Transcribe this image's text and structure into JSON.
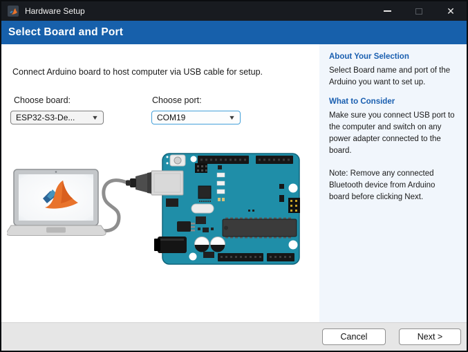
{
  "window": {
    "title": "Hardware Setup"
  },
  "icons": {
    "app": "matlab-logo",
    "minimize": "minimize-dash",
    "maximize": "maximize-square",
    "close": "✕",
    "dropdown_arrow": "▼"
  },
  "header": {
    "title": "Select Board and Port"
  },
  "main": {
    "instruction": "Connect Arduino board to host computer via USB cable for setup.",
    "board_label": "Choose board:",
    "board_value": "ESP32-S3-De...",
    "port_label": "Choose port:",
    "port_value": "COM19"
  },
  "sidebar": {
    "about_heading": "About Your Selection",
    "about_body": "Select Board name and port of the Arduino you want to set up.",
    "consider_heading": "What to Consider",
    "consider_body": "Make sure you connect USB port to the computer and switch on any power adapter connected to the board.",
    "consider_note": "Note: Remove any connected Bluetooth device from Arduino board before clicking Next."
  },
  "footer": {
    "cancel_label": "Cancel",
    "next_label": "Next >"
  },
  "colors": {
    "titlebar_bg": "#181b20",
    "header_blue": "#1760ab",
    "sidebar_bg": "#f1f6fc",
    "sidebar_heading_blue": "#1a5fb0",
    "board_teal": "#1f8ea8",
    "focus_border_blue": "#44a0d9",
    "matlab_orange": "#e8732c"
  }
}
